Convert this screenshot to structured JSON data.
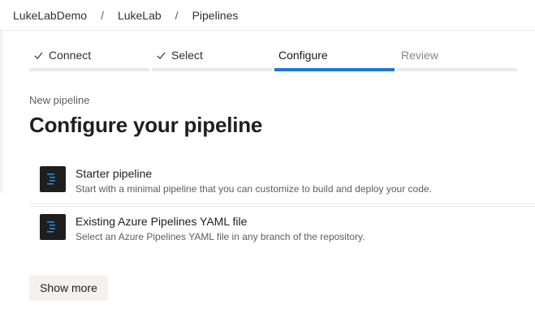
{
  "breadcrumb": {
    "items": [
      "LukeLabDemo",
      "LukeLab",
      "Pipelines"
    ],
    "separator": "/"
  },
  "stepper": {
    "steps": [
      {
        "label": "Connect",
        "state": "done"
      },
      {
        "label": "Select",
        "state": "done"
      },
      {
        "label": "Configure",
        "state": "active"
      },
      {
        "label": "Review",
        "state": "pending"
      }
    ]
  },
  "page": {
    "subtitle": "New pipeline",
    "title": "Configure your pipeline"
  },
  "options": [
    {
      "title": "Starter pipeline",
      "description": "Start with a minimal pipeline that you can customize to build and deploy your code.",
      "icon": "pipeline-file-icon"
    },
    {
      "title": "Existing Azure Pipelines YAML file",
      "description": "Select an Azure Pipelines YAML file in any branch of the repository.",
      "icon": "pipeline-file-icon"
    }
  ],
  "actions": {
    "show_more_label": "Show more"
  },
  "colors": {
    "accent": "#1f78d1",
    "icon_bg": "#1e1e1e",
    "icon_accent": "#2b88d8"
  }
}
